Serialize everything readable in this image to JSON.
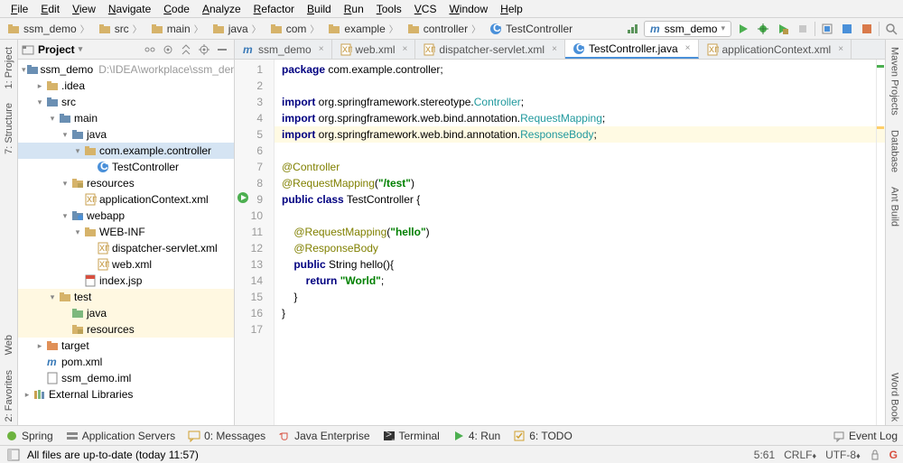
{
  "menu": [
    "File",
    "Edit",
    "View",
    "Navigate",
    "Code",
    "Analyze",
    "Refactor",
    "Build",
    "Run",
    "Tools",
    "VCS",
    "Window",
    "Help"
  ],
  "breadcrumbs": [
    {
      "icon": "folder",
      "label": "ssm_demo"
    },
    {
      "icon": "folder",
      "label": "src"
    },
    {
      "icon": "folder",
      "label": "main"
    },
    {
      "icon": "folder",
      "label": "java"
    },
    {
      "icon": "folder",
      "label": "com"
    },
    {
      "icon": "folder",
      "label": "example"
    },
    {
      "icon": "folder",
      "label": "controller"
    },
    {
      "icon": "class",
      "label": "TestController"
    }
  ],
  "run_config": {
    "label": "ssm_demo"
  },
  "project_panel": {
    "title": "Project"
  },
  "tree": [
    {
      "d": 0,
      "exp": "v",
      "icon": "folder-b",
      "label": "ssm_demo",
      "suffix": "D:\\IDEA\\workplace\\ssm_demo"
    },
    {
      "d": 1,
      "exp": ">",
      "icon": "folder",
      "label": ".idea"
    },
    {
      "d": 1,
      "exp": "v",
      "icon": "folder-b",
      "label": "src"
    },
    {
      "d": 2,
      "exp": "v",
      "icon": "folder-b",
      "label": "main"
    },
    {
      "d": 3,
      "exp": "v",
      "icon": "folder-b",
      "label": "java"
    },
    {
      "d": 4,
      "exp": "v",
      "icon": "folder",
      "label": "com.example.controller",
      "sel": true
    },
    {
      "d": 5,
      "exp": "",
      "icon": "class",
      "label": "TestController"
    },
    {
      "d": 3,
      "exp": "v",
      "icon": "folder-r",
      "label": "resources"
    },
    {
      "d": 4,
      "exp": "",
      "icon": "xml",
      "label": "applicationContext.xml"
    },
    {
      "d": 3,
      "exp": "v",
      "icon": "folder-w",
      "label": "webapp"
    },
    {
      "d": 4,
      "exp": "v",
      "icon": "folder",
      "label": "WEB-INF"
    },
    {
      "d": 5,
      "exp": "",
      "icon": "xml",
      "label": "dispatcher-servlet.xml"
    },
    {
      "d": 5,
      "exp": "",
      "icon": "xml",
      "label": "web.xml"
    },
    {
      "d": 4,
      "exp": "",
      "icon": "jsp",
      "label": "index.jsp"
    },
    {
      "d": 2,
      "exp": "v",
      "icon": "folder",
      "label": "test",
      "hl": true
    },
    {
      "d": 3,
      "exp": "",
      "icon": "folder-g",
      "label": "java",
      "hl": true
    },
    {
      "d": 3,
      "exp": "",
      "icon": "folder-r",
      "label": "resources",
      "hl": true
    },
    {
      "d": 1,
      "exp": ">",
      "icon": "folder-o",
      "label": "target"
    },
    {
      "d": 1,
      "exp": "",
      "icon": "maven",
      "label": "pom.xml"
    },
    {
      "d": 1,
      "exp": "",
      "icon": "file",
      "label": "ssm_demo.iml"
    },
    {
      "d": 0,
      "exp": ">",
      "icon": "lib",
      "label": "External Libraries"
    }
  ],
  "tabs": [
    {
      "icon": "maven",
      "label": "ssm_demo",
      "active": false,
      "close": true
    },
    {
      "icon": "xml",
      "label": "web.xml",
      "active": false,
      "close": true
    },
    {
      "icon": "xml",
      "label": "dispatcher-servlet.xml",
      "active": false,
      "close": true
    },
    {
      "icon": "class",
      "label": "TestController.java",
      "active": true,
      "close": true
    },
    {
      "icon": "xml",
      "label": "applicationContext.xml",
      "active": false,
      "close": true
    }
  ],
  "code": {
    "lines": [
      {
        "n": 1,
        "html": "<span class='kw'>package</span> com.example.controller;"
      },
      {
        "n": 2,
        "html": ""
      },
      {
        "n": 3,
        "html": "<span class='kw'>import</span> org.springframework.stereotype.<span class='cls'>Controller</span>;"
      },
      {
        "n": 4,
        "html": "<span class='kw'>import</span> org.springframework.web.bind.annotation.<span class='cls'>RequestMapping</span>;"
      },
      {
        "n": 5,
        "html": "<span class='kw'>import</span> org.springframework.web.bind.annotation.<span class='cls'>ResponseBody</span>;",
        "hl": true
      },
      {
        "n": 6,
        "html": ""
      },
      {
        "n": 7,
        "html": "<span class='ann'>@Controller</span>"
      },
      {
        "n": 8,
        "html": "<span class='ann'>@RequestMapping</span>(<span class='str'>\"/test\"</span>)"
      },
      {
        "n": 9,
        "html": "<span class='kw'>public</span> <span class='kw'>class</span> TestController {"
      },
      {
        "n": 10,
        "html": ""
      },
      {
        "n": 11,
        "html": "    <span class='ann'>@RequestMapping</span>(<span class='str'>\"hello\"</span>)"
      },
      {
        "n": 12,
        "html": "    <span class='ann'>@ResponseBody</span>"
      },
      {
        "n": 13,
        "html": "    <span class='kw'>public</span> String hello(){"
      },
      {
        "n": 14,
        "html": "        <span class='kw'>return</span> <span class='str'>\"World\"</span>;"
      },
      {
        "n": 15,
        "html": "    }"
      },
      {
        "n": 16,
        "html": "}"
      },
      {
        "n": 17,
        "html": ""
      }
    ]
  },
  "left_tabs": [
    {
      "label": "1: Project",
      "icon": "project"
    },
    {
      "label": "7: Structure",
      "icon": "structure"
    },
    {
      "spacer": true
    },
    {
      "label": "Web",
      "icon": "web"
    },
    {
      "label": "2: Favorites",
      "icon": "fav"
    }
  ],
  "right_tabs": [
    {
      "label": "Maven Projects",
      "icon": "maven"
    },
    {
      "label": "Database",
      "icon": "db"
    },
    {
      "label": "Ant Build",
      "icon": "ant"
    },
    {
      "spacer": true
    },
    {
      "label": "Word Book",
      "icon": "book"
    }
  ],
  "bottom": [
    {
      "icon": "spring",
      "label": "Spring"
    },
    {
      "icon": "server",
      "label": "Application Servers"
    },
    {
      "icon": "msg",
      "label": "0: Messages"
    },
    {
      "icon": "java",
      "label": "Java Enterprise"
    },
    {
      "icon": "term",
      "label": "Terminal"
    },
    {
      "icon": "run",
      "label": "4: Run"
    },
    {
      "icon": "todo",
      "label": "6: TODO"
    }
  ],
  "bottom_right": {
    "label": "Event Log"
  },
  "status": {
    "left": "All files are up-to-date (today 11:57)",
    "pos": "5:61",
    "sep": "CRLF",
    "enc": "UTF-8",
    "lock": "",
    "git": ""
  }
}
